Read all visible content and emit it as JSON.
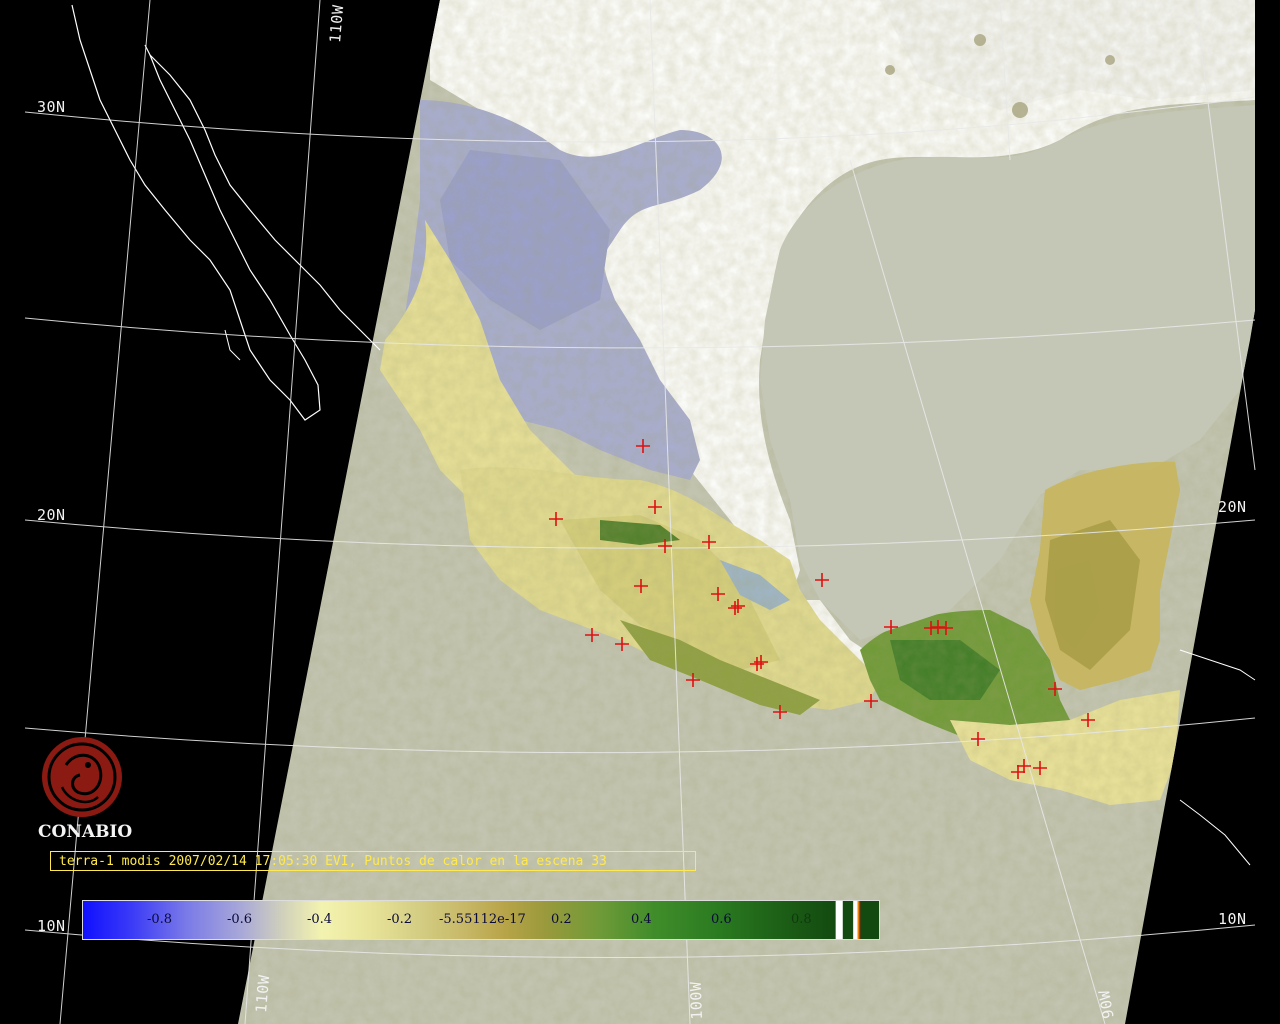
{
  "map": {
    "graticule_labels": {
      "lat_30_left": "30N",
      "lat_20_left": "20N",
      "lat_20_right": "20N",
      "lat_10_left": "10N",
      "lat_10_right": "10N",
      "lon_110_top": "110W",
      "lon_110_bottom": "110W",
      "lon_100_bottom": "100W",
      "lon_90_bottom": "90W"
    },
    "hotspot_marker_color": "#e01010",
    "coastline_color": "#ffffff",
    "no_data_color": "#c5c7b6"
  },
  "branding": {
    "logo_text": "CONABIO",
    "logo_color": "#8a1a12"
  },
  "caption": {
    "text": "terra-1 modis 2007/02/14 17:05:30 EVI, Puntos de calor en la escena 33"
  },
  "legend": {
    "ticks": [
      "-0.8",
      "-0.6",
      "-0.4",
      "-0.2",
      "-5.55112e-17",
      "0.2",
      "0.4",
      "0.6",
      "0.8"
    ]
  }
}
